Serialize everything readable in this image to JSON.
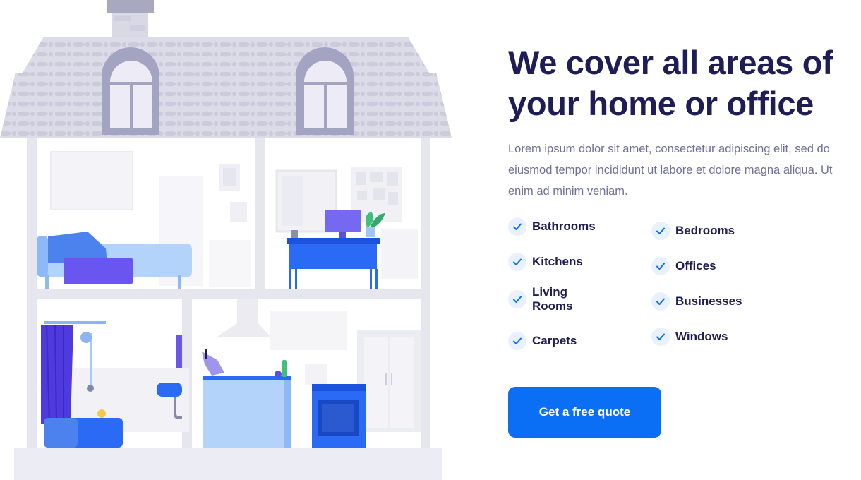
{
  "hero": {
    "title": "We cover all areas of\nyour home or office",
    "description": "Lorem ipsum dolor sit amet, consectetur adipiscing elit, sed do eiusmod tempor incididunt ut labore et dolore magna aliqua. Ut enim ad minim veniam.",
    "cta_label": "Get a free quote"
  },
  "areas": {
    "left": [
      "Bathrooms",
      "Kitchens",
      "Living\nRooms",
      "Carpets"
    ],
    "right": [
      "Bedrooms",
      "Offices",
      "Businesses",
      "Windows"
    ]
  },
  "icons": {
    "check": "check-icon",
    "illustration": "house-cutaway-illustration"
  },
  "colors": {
    "accent": "#0b6ff5",
    "heading": "#1f1d55",
    "body": "#6e7196",
    "check_bg": "#e8f1fd"
  }
}
